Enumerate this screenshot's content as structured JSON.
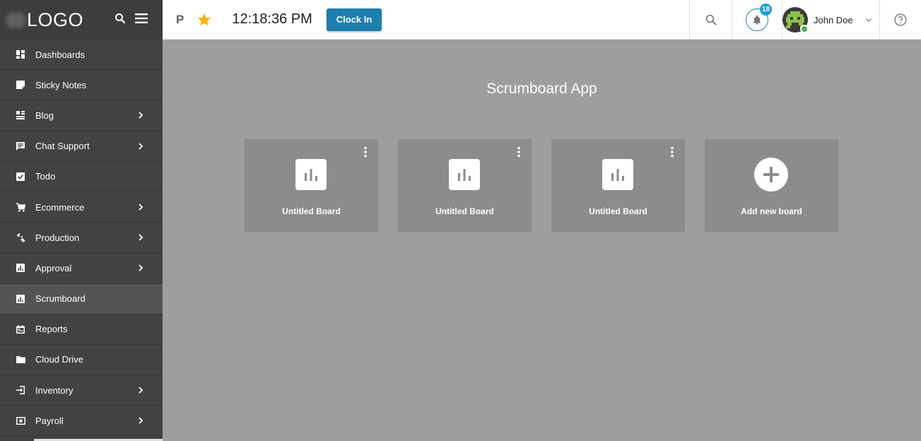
{
  "sidebar": {
    "logo": "LOGO",
    "items": [
      {
        "label": "Dashboards",
        "icon": "dashboard-icon",
        "chevron": false
      },
      {
        "label": "Sticky Notes",
        "icon": "sticky-note-icon",
        "chevron": false
      },
      {
        "label": "Blog",
        "icon": "blog-icon",
        "chevron": true
      },
      {
        "label": "Chat Support",
        "icon": "chat-icon",
        "chevron": true
      },
      {
        "label": "Todo",
        "icon": "checkbox-icon",
        "chevron": false
      },
      {
        "label": "Ecommerce",
        "icon": "cart-icon",
        "chevron": true
      },
      {
        "label": "Production",
        "icon": "wrench-icon",
        "chevron": true
      },
      {
        "label": "Approval",
        "icon": "chart-icon",
        "chevron": true
      },
      {
        "label": "Scrumboard",
        "icon": "chart-icon",
        "chevron": false,
        "active": true
      },
      {
        "label": "Reports",
        "icon": "calendar-icon",
        "chevron": false
      },
      {
        "label": "Cloud Drive",
        "icon": "folder-icon",
        "chevron": false
      },
      {
        "label": "Inventory",
        "icon": "login-icon",
        "chevron": true
      },
      {
        "label": "Payroll",
        "icon": "money-icon",
        "chevron": true
      }
    ]
  },
  "topbar": {
    "p_label": "P",
    "time": "12:18:36 PM",
    "clock_in_label": "Clock In",
    "notification_count": "18",
    "user_name": "John Doe"
  },
  "main": {
    "title": "Scrumboard App",
    "boards": [
      {
        "label": "Untitled Board"
      },
      {
        "label": "Untitled Board"
      },
      {
        "label": "Untitled Board"
      }
    ],
    "add_board_label": "Add new board"
  },
  "colors": {
    "sidebar_bg": "#424242",
    "accent": "#1e7fad",
    "star": "#f5b400",
    "main_bg": "#9e9e9e",
    "board_bg": "#8c8c8c"
  }
}
